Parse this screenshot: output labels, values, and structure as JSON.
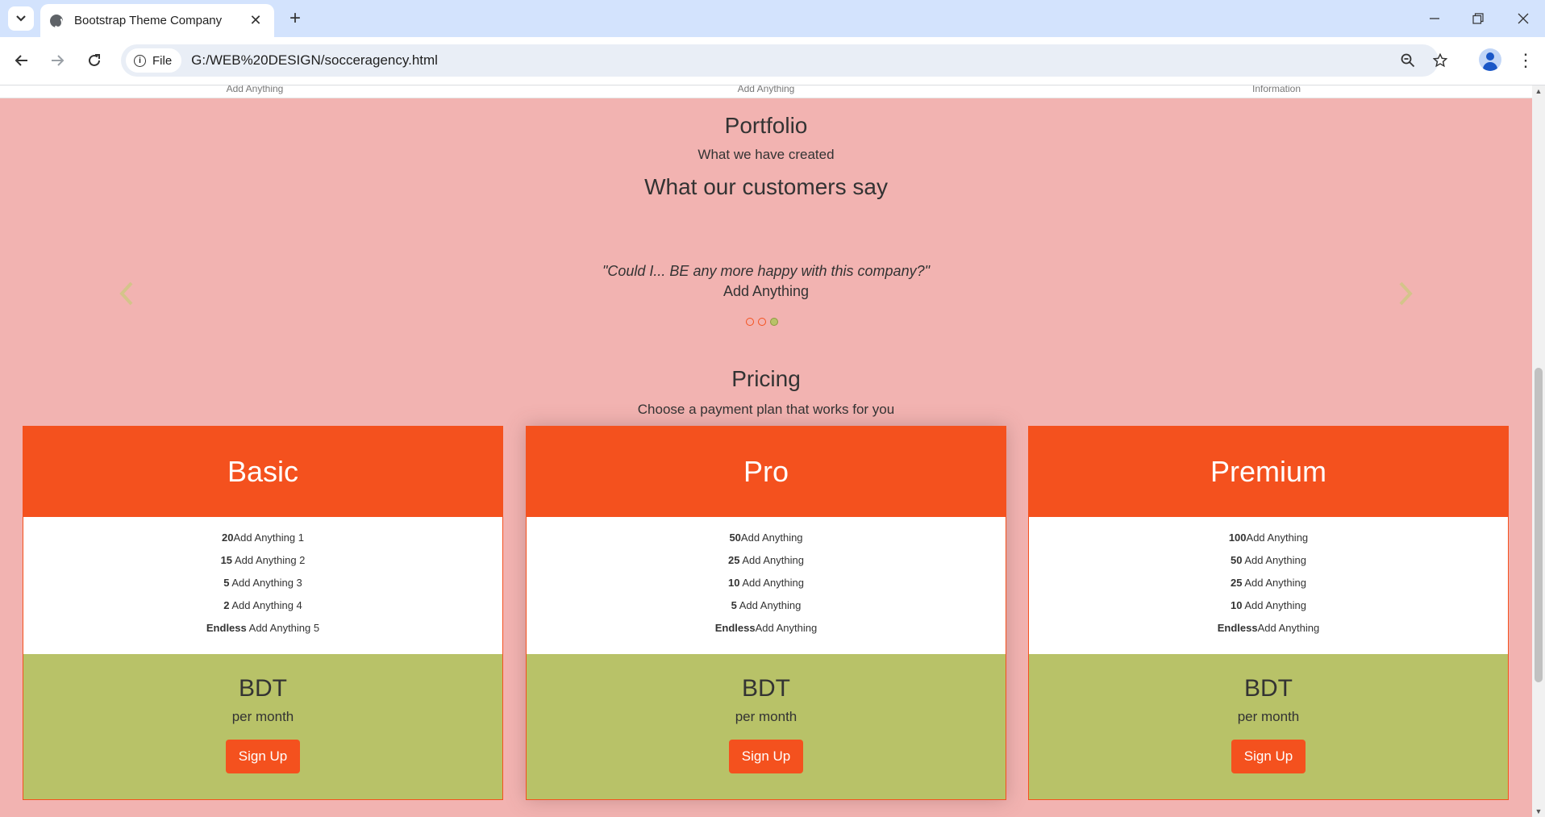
{
  "browser": {
    "tab_title": "Bootstrap Theme Company",
    "chip_label": "File",
    "url": "G:/WEB%20DESIGN/socceragency.html"
  },
  "top_strip": [
    "Add Anything",
    "Add Anything",
    "Information"
  ],
  "portfolio": {
    "title": "Portfolio",
    "subtitle": "What we have created"
  },
  "testimonials": {
    "title": "What our customers say",
    "quote": "\"Could I... BE any more happy with this company?\"",
    "author": "Add Anything",
    "active_slide": 3,
    "slide_count": 3
  },
  "pricing": {
    "title": "Pricing",
    "subtitle": "Choose a payment plan that works for you",
    "plans": [
      {
        "name": "Basic",
        "features": [
          {
            "num": "20",
            "text": "Add Anything 1"
          },
          {
            "num": "15",
            "text": " Add Anything 2"
          },
          {
            "num": "5",
            "text": " Add Anything 3"
          },
          {
            "num": "2",
            "text": " Add Anything 4"
          },
          {
            "num": "Endless",
            "text": " Add Anything 5"
          }
        ],
        "currency": "BDT",
        "period": "per month",
        "button": "Sign Up"
      },
      {
        "name": "Pro",
        "features": [
          {
            "num": "50",
            "text": "Add Anything"
          },
          {
            "num": "25",
            "text": " Add Anything"
          },
          {
            "num": "10",
            "text": " Add Anything"
          },
          {
            "num": "5",
            "text": " Add Anything"
          },
          {
            "num": "Endless",
            "text": "Add Anything"
          }
        ],
        "currency": "BDT",
        "period": "per month",
        "button": "Sign Up"
      },
      {
        "name": "Premium",
        "features": [
          {
            "num": "100",
            "text": "Add Anything"
          },
          {
            "num": "50",
            "text": " Add Anything"
          },
          {
            "num": "25",
            "text": " Add Anything"
          },
          {
            "num": "10",
            "text": " Add Anything"
          },
          {
            "num": "Endless",
            "text": "Add Anything"
          }
        ],
        "currency": "BDT",
        "period": "per month",
        "button": "Sign Up"
      }
    ]
  },
  "colors": {
    "page_bg": "#f2b3b1",
    "accent": "#f4511e",
    "card_footer": "#b8c268",
    "arrow": "#d4c48a"
  }
}
